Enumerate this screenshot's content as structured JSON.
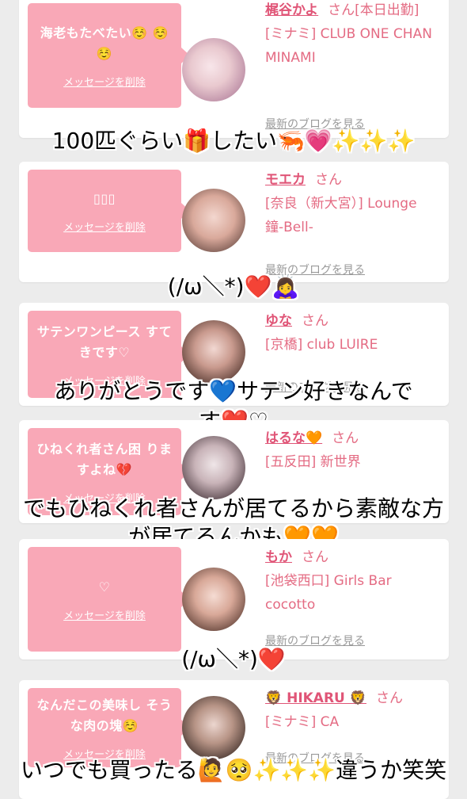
{
  "cards": [
    {
      "message": "海老もたべたい☺️ ☺️☺️",
      "delete_label": "メッセージを削除",
      "name": "梶谷かよ",
      "san": "さん[本日出勤]",
      "shop": "[ミナミ] CLUB ONE CHAN MINAMI",
      "blog_label": "最新のブログを見る",
      "overlay": "100匹ぐらい🎁したい🦐💗✨✨✨"
    },
    {
      "message": "▯▯▯",
      "delete_label": "メッセージを削除",
      "name": "モエカ",
      "san": "さん",
      "shop": "[奈良（新大宮）] Lounge 鐘-Bell-",
      "blog_label": "最新のブログを見る",
      "overlay": "(/ω＼*)❤️🙇‍♀️"
    },
    {
      "message": "サテンワンピース すてきです♡",
      "delete_label": "メッセージを削除",
      "name": "ゆな",
      "san": "さん",
      "shop": "[京橋] club LUIRE",
      "blog_label": "最新のブログを見る",
      "overlay_line1": "ありがとうです💙サテン好きなんで",
      "overlay_line2": "す❤️♡"
    },
    {
      "message": "ひねくれ者さん困 りますよね💔",
      "delete_label": "メッセージを削除",
      "name": "はるな🧡",
      "san": "さん",
      "shop": "[五反田] 新世界",
      "blog_label": "最新のブログを見る",
      "overlay_line1": "でもひねくれ者さんが居てるから素敵な方",
      "overlay_line2": "が居てるんかも🧡🧡"
    },
    {
      "message": "♡",
      "delete_label": "メッセージを削除",
      "name": "もか",
      "san": "さん",
      "shop": "[池袋西口] Girls Bar cocotto",
      "blog_label": "最新のブログを見る",
      "overlay": "(/ω＼*)❤️"
    },
    {
      "message": "なんだこの美味し そうな肉の塊☺️",
      "delete_label": "メッセージを削除",
      "name": "🦁 HIKARU 🦁",
      "san": "さん",
      "shop": "[ミナミ] CA",
      "blog_label": "最新のブログを見る",
      "overlay": "いつでも買ったる🙋🥺✨✨✨違うか笑笑"
    }
  ],
  "colors": {
    "bubble": "#f9a8b7",
    "accent": "#e05577",
    "link_text": "#e46b83",
    "background": "#ececec"
  }
}
